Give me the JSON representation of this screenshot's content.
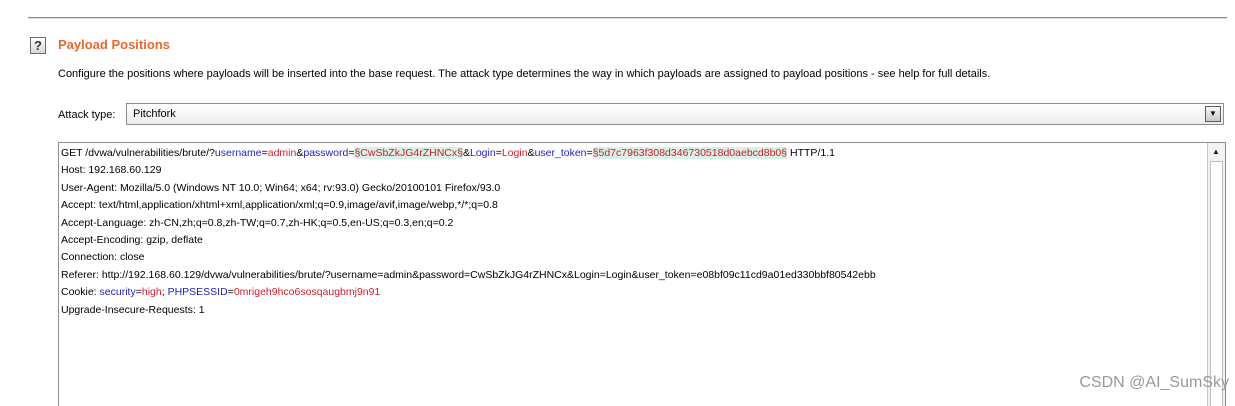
{
  "section": {
    "title": "Payload Positions",
    "help_glyph": "?",
    "description": "Configure the positions where payloads will be inserted into the base request. The attack type determines the way in which payloads are assigned to payload positions - see help for full details."
  },
  "attack": {
    "label": "Attack type:",
    "value": "Pitchfork",
    "arrow_glyph": "▼"
  },
  "request": {
    "line1": {
      "prefix": "GET /dvwa/vulnerabilities/brute/?",
      "k_username": "username",
      "eq1": "=",
      "v_username": "admin",
      "amp1": "&",
      "k_password": "password",
      "eq2": "=",
      "p_password": "§CwSbZkJG4rZHNCx§",
      "amp2": "&",
      "k_login": "Login",
      "eq3": "=",
      "v_login": "Login",
      "amp3": "&",
      "k_token": "user_token",
      "eq4": "=",
      "p_token": "§5d7c7963f308d346730518d0aebcd8b0§",
      "suffix": " HTTP/1.1"
    },
    "host": "Host: 192.168.60.129",
    "user_agent": "User-Agent: Mozilla/5.0 (Windows NT 10.0; Win64; x64; rv:93.0) Gecko/20100101 Firefox/93.0",
    "accept": "Accept: text/html,application/xhtml+xml,application/xml;q=0.9,image/avif,image/webp,*/*;q=0.8",
    "accept_language": "Accept-Language: zh-CN,zh;q=0.8,zh-TW;q=0.7,zh-HK;q=0.5,en-US;q=0.3,en;q=0.2",
    "accept_encoding": "Accept-Encoding: gzip, deflate",
    "connection": "Connection: close",
    "referer": "Referer: http://192.168.60.129/dvwa/vulnerabilities/brute/?username=admin&password=CwSbZkJG4rZHNCx&Login=Login&user_token=e08bf09c11cd9a01ed330bbf80542ebb",
    "cookie": {
      "prefix": "Cookie: ",
      "k_security": "security",
      "eq1": "=",
      "v_security": "high",
      "sep": "; ",
      "k_session": "PHPSESSID",
      "eq2": "=",
      "v_session": "0mrigeh9hco6sosqaugbmj9n91"
    },
    "upgrade": "Upgrade-Insecure-Requests: 1"
  },
  "scrollbar": {
    "up_glyph": "▲"
  },
  "watermark": "CSDN @AI_SumSky",
  "colors": {
    "title": "#e8692d",
    "param_name": "#1f1fbf",
    "param_value": "#d4202c",
    "payload_highlight": "#d8f0e6"
  },
  "icons": [
    "help-icon",
    "dropdown-arrow-icon",
    "scroll-up-arrow-icon"
  ]
}
